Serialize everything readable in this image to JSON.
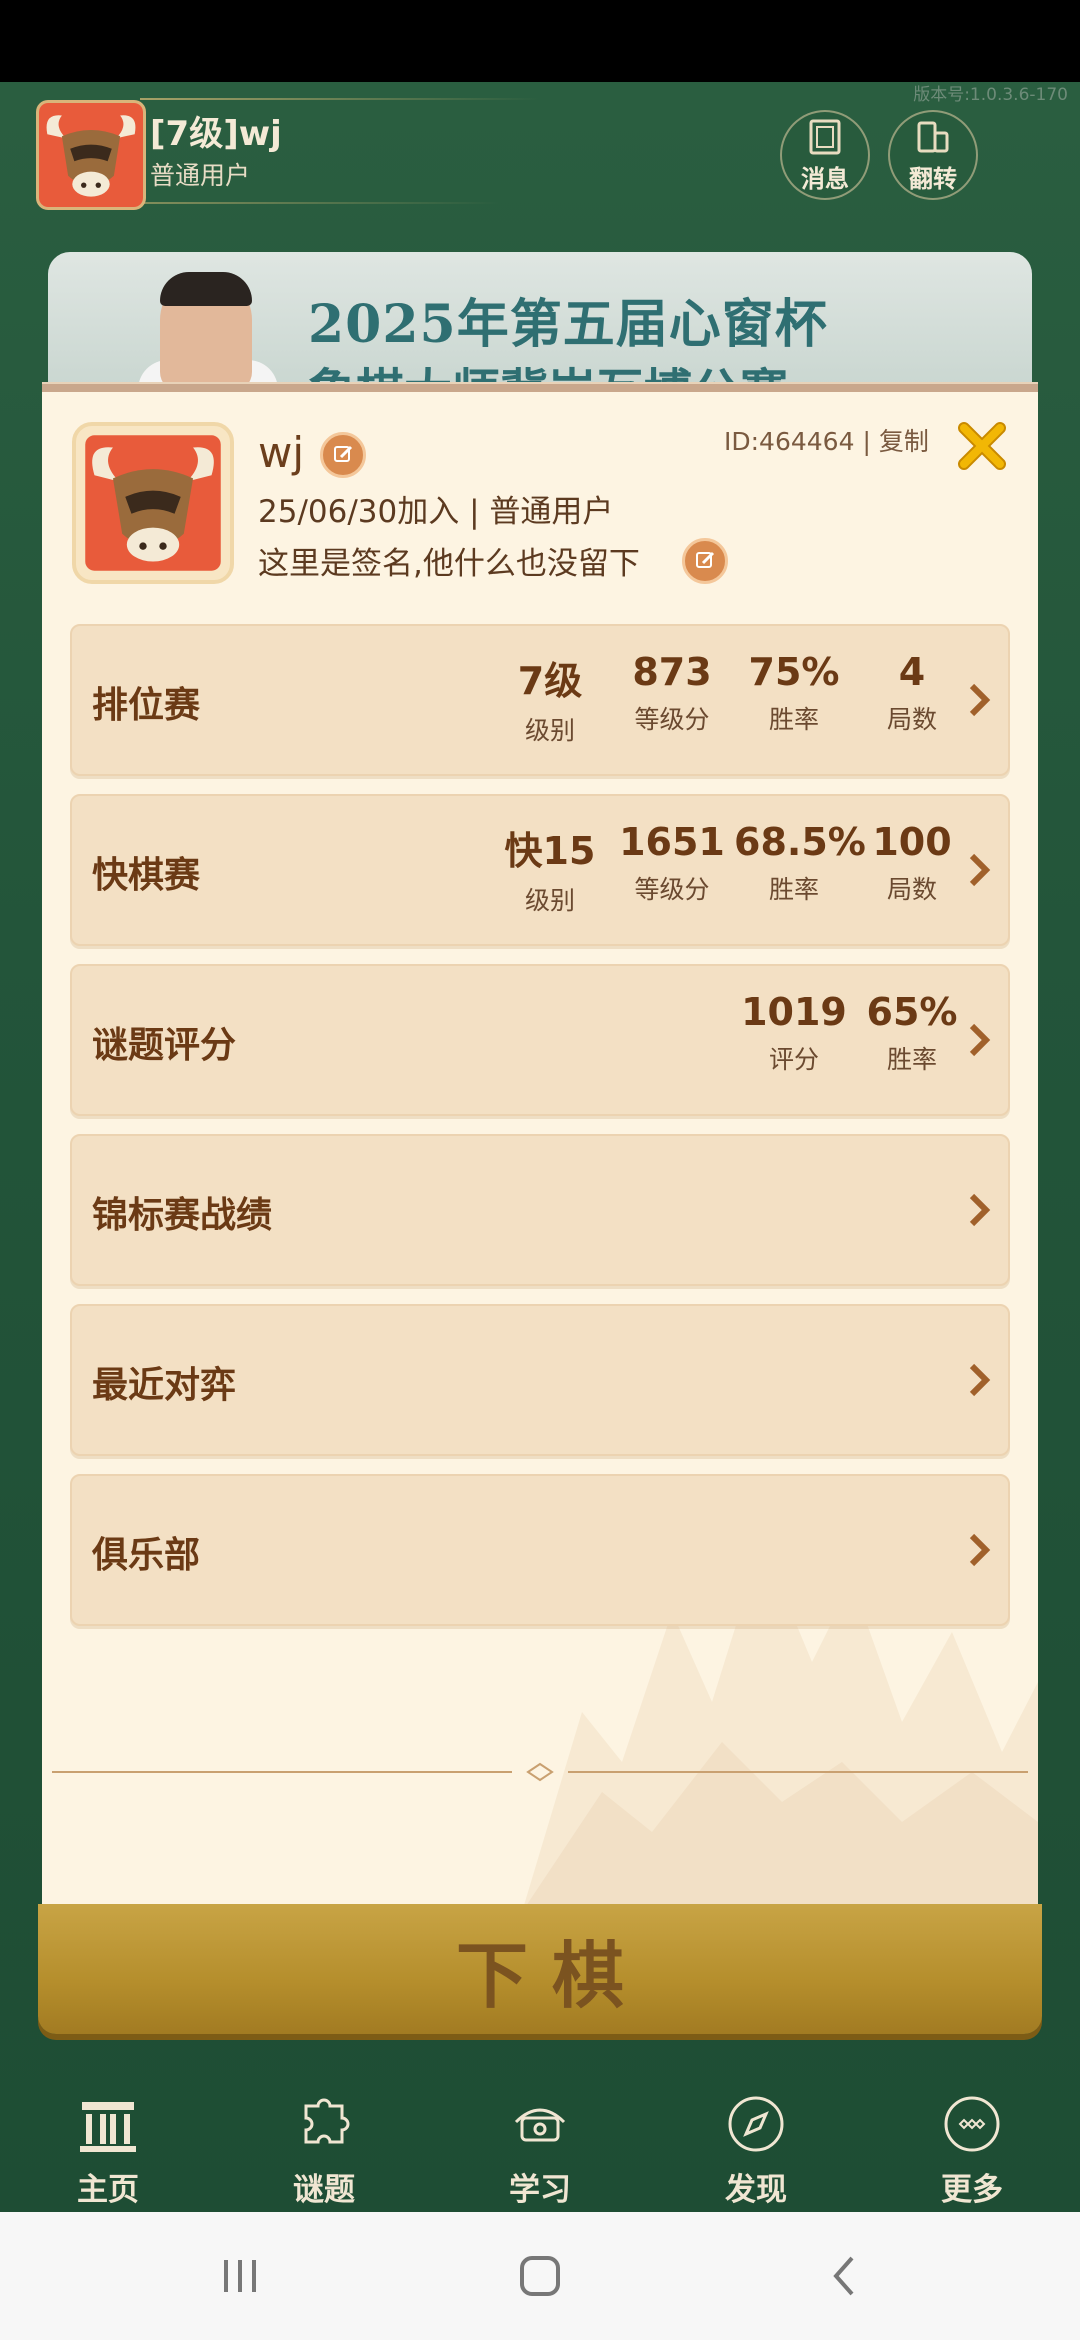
{
  "app": {
    "version": "版本号:1.0.3.6-170"
  },
  "header": {
    "name": "[7级]wj",
    "subtitle": "普通用户",
    "messages_label": "消息",
    "flip_label": "翻转"
  },
  "banner": {
    "title_line1": "2025年第五届心窗杯",
    "title_line2": "象棋大师冀岩互博公赛"
  },
  "profile": {
    "name": "wj",
    "id_text": "ID:464464",
    "separator": "|",
    "copy_label": "复制",
    "join_line": "25/06/30加入 | 普通用户",
    "signature": "这里是签名,他什么也没留下"
  },
  "cards": {
    "ranked": {
      "title": "排位赛",
      "stats": [
        {
          "value": "7级",
          "label": "级别"
        },
        {
          "value": "873",
          "label": "等级分"
        },
        {
          "value": "75%",
          "label": "胜率"
        },
        {
          "value": "4",
          "label": "局数"
        }
      ]
    },
    "blitz": {
      "title": "快棋赛",
      "stats": [
        {
          "value": "快15",
          "label": "级别"
        },
        {
          "value": "1651",
          "label": "等级分"
        },
        {
          "value": "68.5%",
          "label": "胜率"
        },
        {
          "value": "100",
          "label": "局数"
        }
      ]
    },
    "puzzle": {
      "title": "谜题评分",
      "stats": [
        {
          "value": "1019",
          "label": "评分"
        },
        {
          "value": "65%",
          "label": "胜率"
        }
      ]
    },
    "championship": {
      "title": "锦标赛战绩"
    },
    "recent": {
      "title": "最近对弈"
    },
    "club": {
      "title": "俱乐部"
    }
  },
  "play_button": {
    "label": "下棋"
  },
  "nav": [
    {
      "label": "主页",
      "icon": "home-icon"
    },
    {
      "label": "谜题",
      "icon": "puzzle-icon"
    },
    {
      "label": "学习",
      "icon": "learn-icon"
    },
    {
      "label": "发现",
      "icon": "compass-icon"
    },
    {
      "label": "更多",
      "icon": "more-icon"
    }
  ],
  "colors": {
    "background_green": "#23553a",
    "panel_cream": "#fdf4e2",
    "card_tan": "#f3e0c4",
    "text_brown": "#6b3a15",
    "button_gold": "#b58e2c",
    "close_yellow": "#f2b705"
  }
}
